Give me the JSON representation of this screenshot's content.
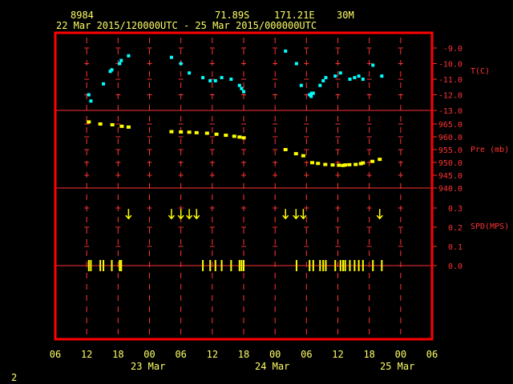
{
  "header": {
    "station_id": "8984",
    "lat": "71.89S",
    "lon": "171.21E",
    "height": "30M",
    "time_range": "22 Mar 2015/120000UTC - 25 Mar 2015/000000UTC"
  },
  "footer": {
    "page_number": "2"
  },
  "colors": {
    "frame": "#ff0000",
    "grid": "#ff3333",
    "axis_text": "#ffff66",
    "temperature": "#00ffff",
    "pressure": "#ffff00",
    "wind": "#ffff00"
  },
  "chart_data": [
    {
      "type": "scatter",
      "panel": "temperature",
      "ylabel": "T(C)",
      "ylim": [
        -13.0,
        -9.0
      ],
      "yticks": [
        "-9.0",
        "-10.0",
        "-11.0",
        "-12.0",
        "-13.0"
      ],
      "ytick_values": [
        -9.0,
        -10.0,
        -11.0,
        -12.0,
        -13.0
      ],
      "x_hours": [
        12.4,
        12.8,
        15.2,
        16.5,
        16.8,
        18.3,
        18.6,
        20.0,
        28.2,
        30.0,
        31.6,
        34.2,
        35.6,
        36.6,
        37.8,
        39.6,
        41.2,
        41.6,
        42.0,
        50.0,
        52.1,
        53.0,
        54.6,
        54.9,
        55.0,
        55.3,
        56.6,
        57.2,
        57.7,
        59.5,
        60.5,
        62.3,
        63.2,
        64.0,
        64.8,
        66.7,
        68.4
      ],
      "values": [
        -12.0,
        -12.4,
        -11.3,
        -10.5,
        -10.4,
        -10.0,
        -9.8,
        -9.5,
        -9.6,
        -10.0,
        -10.6,
        -10.9,
        -11.1,
        -11.1,
        -10.9,
        -11.0,
        -11.4,
        -11.6,
        -11.8,
        -9.2,
        -10.0,
        -11.4,
        -12.0,
        -12.1,
        -11.9,
        -11.9,
        -11.4,
        -11.1,
        -10.9,
        -10.8,
        -10.6,
        -11.0,
        -10.9,
        -10.8,
        -11.0,
        -10.1,
        -10.8
      ]
    },
    {
      "type": "scatter",
      "panel": "pressure",
      "ylabel": "Pre (mb)",
      "ylim": [
        940.0,
        965.0
      ],
      "yticks": [
        "965.0",
        "960.0",
        "955.0",
        "950.0",
        "945.0",
        "940.0"
      ],
      "ytick_values": [
        965.0,
        960.0,
        955.0,
        950.0,
        945.0,
        940.0
      ],
      "x_hours": [
        12.4,
        14.6,
        16.9,
        18.7,
        20.0,
        28.2,
        30.0,
        31.6,
        33.0,
        35.0,
        36.8,
        38.6,
        40.2,
        41.2,
        42.0,
        50.0,
        52.0,
        53.4,
        55.1,
        56.2,
        57.6,
        59.0,
        60.2,
        61.0,
        61.4,
        62.2,
        63.4,
        64.4,
        64.8,
        66.6,
        68.0
      ],
      "values": [
        965.8,
        965.0,
        964.7,
        964.1,
        963.8,
        962.0,
        961.9,
        961.8,
        961.6,
        961.4,
        961.0,
        960.6,
        960.2,
        959.9,
        959.6,
        955.0,
        953.4,
        952.6,
        949.9,
        949.6,
        949.2,
        949.0,
        948.9,
        948.8,
        949.0,
        949.1,
        949.2,
        949.5,
        949.8,
        950.4,
        951.2
      ]
    },
    {
      "type": "scatter",
      "panel": "wind",
      "ylabel": "SPD(MPS)",
      "ylim": [
        0.0,
        0.3
      ],
      "yticks": [
        "0.3",
        "0.2",
        "0.1",
        "0.0"
      ],
      "ytick_values": [
        0.3,
        0.2,
        0.1,
        0.0
      ],
      "arrow_x_hours": [
        20.0,
        28.2,
        30.0,
        31.6,
        33.0,
        50.0,
        52.0,
        53.4,
        68.0
      ],
      "arrow_values": [
        0.27,
        0.27,
        0.27,
        0.27,
        0.27,
        0.27,
        0.27,
        0.27,
        0.27
      ],
      "speed_x_hours": [
        12.4,
        12.8,
        14.6,
        15.2,
        16.8,
        18.3,
        18.6,
        34.2,
        35.6,
        36.6,
        37.8,
        39.6,
        41.2,
        41.6,
        42.0,
        52.1,
        54.6,
        55.3,
        56.6,
        57.2,
        57.7,
        59.5,
        60.5,
        61.0,
        61.4,
        62.3,
        63.2,
        64.0,
        64.8,
        66.7,
        68.4
      ],
      "speed_values": [
        0.0,
        0.0,
        0.0,
        0.0,
        0.0,
        0.0,
        0.0,
        0.0,
        0.0,
        0.0,
        0.0,
        0.0,
        0.0,
        0.0,
        0.0,
        0.0,
        0.0,
        0.0,
        0.0,
        0.0,
        0.0,
        0.0,
        0.0,
        0.0,
        0.0,
        0.0,
        0.0,
        0.0,
        0.0,
        0.0,
        0.0
      ]
    }
  ],
  "x_axis": {
    "xlim_hours": [
      6,
      78
    ],
    "tick_hours": [
      6,
      12,
      18,
      24,
      30,
      36,
      42,
      48,
      54,
      60,
      66,
      72,
      78
    ],
    "tick_labels": [
      "06",
      "12",
      "18",
      "00",
      "06",
      "12",
      "18",
      "00",
      "06",
      "12",
      "18",
      "00",
      "06"
    ],
    "date_labels": [
      "23 Mar",
      "24 Mar",
      "25 Mar"
    ]
  }
}
